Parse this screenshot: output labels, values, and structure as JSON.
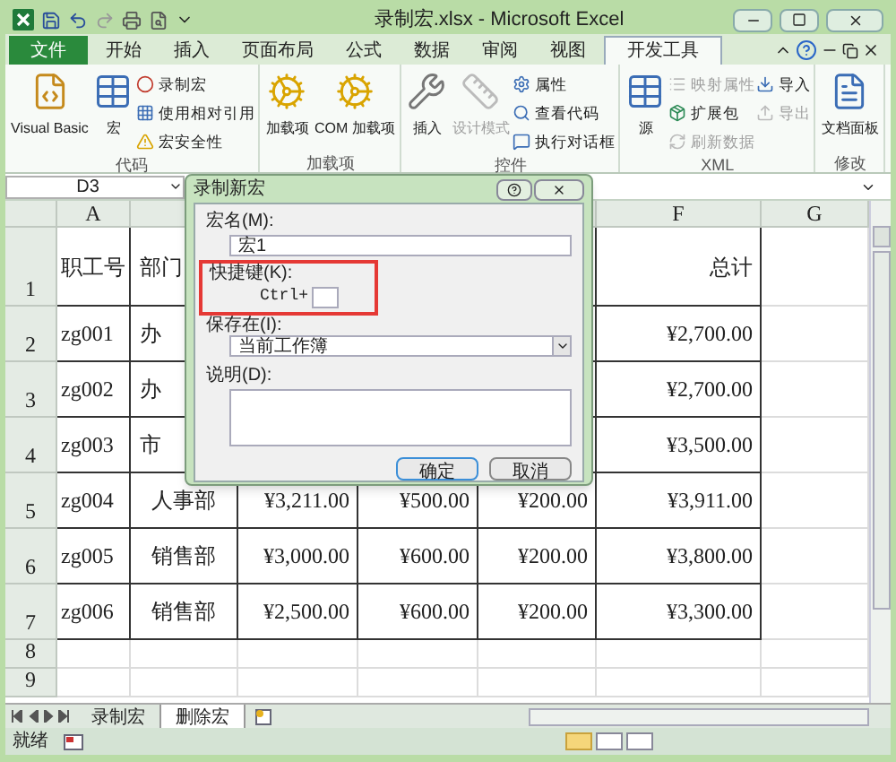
{
  "window": {
    "title": "录制宏.xlsx - Microsoft Excel"
  },
  "tabs": [
    {
      "label": "文件",
      "kind": "file",
      "selected": false
    },
    {
      "label": "开始",
      "kind": "tab",
      "selected": false
    },
    {
      "label": "插入",
      "kind": "tab",
      "selected": false
    },
    {
      "label": "页面布局",
      "kind": "tab",
      "selected": false
    },
    {
      "label": "公式",
      "kind": "tab",
      "selected": false
    },
    {
      "label": "数据",
      "kind": "tab",
      "selected": false
    },
    {
      "label": "审阅",
      "kind": "tab",
      "selected": false
    },
    {
      "label": "视图",
      "kind": "tab",
      "selected": false
    },
    {
      "label": "开发工具",
      "kind": "tab",
      "selected": true
    }
  ],
  "ribbon": [
    {
      "label": "代码",
      "items": [
        {
          "kind": "large",
          "label": "Visual Basic",
          "disabled": false
        },
        {
          "kind": "large",
          "label": "宏",
          "disabled": false
        },
        {
          "kind": "small",
          "label": "录制宏",
          "disabled": false
        },
        {
          "kind": "small",
          "label": "使用相对引用",
          "disabled": false
        },
        {
          "kind": "small",
          "label": "宏安全性",
          "disabled": false
        }
      ]
    },
    {
      "label": "加载项",
      "items": [
        {
          "kind": "large",
          "label": "加载项",
          "disabled": false
        },
        {
          "kind": "large",
          "label": "COM 加载项",
          "disabled": false
        }
      ]
    },
    {
      "label": "控件",
      "items": [
        {
          "kind": "large",
          "label": "插入",
          "disabled": false
        },
        {
          "kind": "large",
          "label": "设计模式",
          "disabled": true
        },
        {
          "kind": "small",
          "label": "属性",
          "disabled": false
        },
        {
          "kind": "small",
          "label": "查看代码",
          "disabled": false
        },
        {
          "kind": "small",
          "label": "执行对话框",
          "disabled": false
        }
      ]
    },
    {
      "label": "XML",
      "items": [
        {
          "kind": "large",
          "label": "源",
          "disabled": false
        },
        {
          "kind": "small",
          "label": "映射属性",
          "disabled": true
        },
        {
          "kind": "small",
          "label": "扩展包",
          "disabled": false
        },
        {
          "kind": "small",
          "label": "刷新数据",
          "disabled": true
        },
        {
          "kind": "small",
          "label": "导入",
          "disabled": false
        },
        {
          "kind": "small",
          "label": "导出",
          "disabled": true
        }
      ]
    },
    {
      "label": "修改",
      "items": [
        {
          "kind": "large",
          "label": "文档面板",
          "disabled": false
        }
      ]
    }
  ],
  "name_box": "D3",
  "column_headers_left": [
    "A"
  ],
  "column_headers_right": [
    "F",
    "G"
  ],
  "rows": [
    {
      "number": "1",
      "cells": [
        "职工号",
        "部门"
      ],
      "cells_right": [
        "总计"
      ]
    },
    {
      "number": "2",
      "cells": [
        "zg001",
        "办"
      ],
      "cells_right": [
        "¥2,700.00"
      ]
    },
    {
      "number": "3",
      "cells": [
        "zg002",
        "办"
      ],
      "cells_right": [
        "¥2,700.00"
      ]
    },
    {
      "number": "4",
      "cells": [
        "zg003",
        "市"
      ],
      "cells_right": [
        "¥3,500.00"
      ]
    },
    {
      "number": "5",
      "cells": [
        "zg004",
        "人事部",
        "¥3,211.00",
        "¥500.00",
        "¥200.00"
      ],
      "cells_right": [
        "¥3,911.00"
      ]
    },
    {
      "number": "6",
      "cells": [
        "zg005",
        "销售部",
        "¥3,000.00",
        "¥600.00",
        "¥200.00"
      ],
      "cells_right": [
        "¥3,800.00"
      ]
    },
    {
      "number": "7",
      "cells": [
        "zg006",
        "销售部",
        "¥2,500.00",
        "¥600.00",
        "¥200.00"
      ],
      "cells_right": [
        "¥3,300.00"
      ]
    },
    {
      "number": "8"
    },
    {
      "number": "9"
    }
  ],
  "sheet_tabs": [
    {
      "label": "录制宏",
      "selected": false
    },
    {
      "label": "删除宏",
      "selected": true
    }
  ],
  "status_bar": {
    "text": "就绪"
  },
  "dialog": {
    "title": "录制新宏",
    "name_label": "宏名(M):",
    "name_value": "宏1",
    "shortcut_label": "快捷键(K):",
    "shortcut_prefix": "Ctrl+",
    "shortcut_highlighted": true,
    "store_label": "保存在(I):",
    "store_value": "当前工作簿",
    "description_label": "说明(D):",
    "buttons": [
      {
        "label": "确定",
        "default": true
      },
      {
        "label": "取消",
        "default": false
      }
    ]
  }
}
